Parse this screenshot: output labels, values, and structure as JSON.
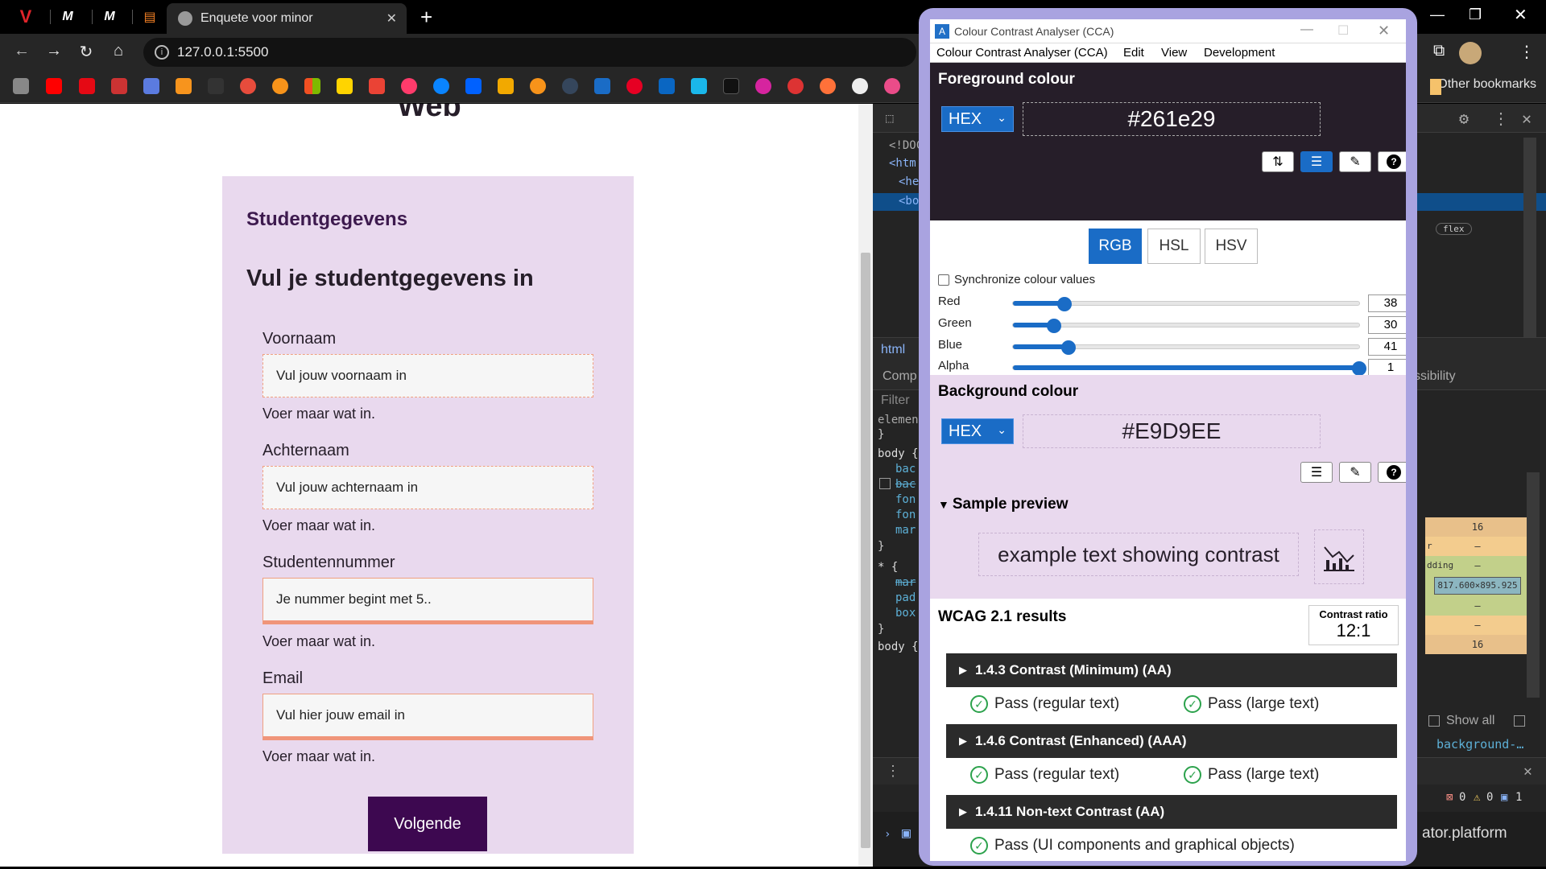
{
  "browser": {
    "tabs": [
      {
        "label": "V"
      },
      {
        "label": "M"
      },
      {
        "label": "M"
      }
    ],
    "active_tab_title": "Enquete voor minor",
    "url": "127.0.0.1:5500",
    "other_bookmarks": "Other bookmarks"
  },
  "page": {
    "heading": "Web",
    "section_label": "Studentgegevens",
    "form_title": "Vul je studentgegevens in",
    "fields": [
      {
        "label": "Voornaam",
        "placeholder": "Vul jouw voornaam in",
        "hint": "Voer maar wat in."
      },
      {
        "label": "Achternaam",
        "placeholder": "Vul jouw achternaam  in",
        "hint": "Voer maar wat in."
      },
      {
        "label": "Studentennummer",
        "placeholder": "Je nummer begint met 5..",
        "hint": "Voer maar wat in."
      },
      {
        "label": "Email",
        "placeholder": "Vul hier jouw email in",
        "hint": "Voer maar wat in."
      }
    ],
    "next_button": "Volgende"
  },
  "devtools": {
    "dom_lines": [
      "<!DOC",
      "<htm",
      "<he",
      "<bo"
    ],
    "flex_badge": "flex",
    "breadcrumb": "html",
    "tab_computed": "Comp",
    "tab_accessibility": "ssibility",
    "filter_placeholder": "Filter",
    "element_style": "elemen",
    "rules": [
      {
        "selector": "body {",
        "props": [
          "bac",
          "bac",
          "fon",
          "fon",
          "mar"
        ]
      },
      {
        "selector": "* {",
        "props": [
          "mar",
          "pad",
          "box"
        ]
      }
    ],
    "rule_body_next": "body {",
    "box_model": [
      "16",
      "–",
      "–",
      "817.600×895.925",
      "–",
      "–",
      "16"
    ],
    "box_labels": {
      "border": "r",
      "padding": "dding"
    },
    "show_all": "Show all",
    "computed_prop": "background-…",
    "errors": "0",
    "warnings": "0",
    "messages": "1",
    "console_tail": "ator.platform"
  },
  "cca": {
    "window_title": "Colour Contrast Analyser (CCA)",
    "menu": [
      "Colour Contrast Analyser (CCA)",
      "Edit",
      "View",
      "Development"
    ],
    "foreground": {
      "title": "Foreground colour",
      "format": "HEX",
      "value": "#261e29",
      "color": "#261e29"
    },
    "modes": [
      "RGB",
      "HSL",
      "HSV"
    ],
    "active_mode": "RGB",
    "sync_label": "Synchronize colour values",
    "sliders": [
      {
        "label": "Red",
        "value": 38,
        "fraction": 0.149
      },
      {
        "label": "Green",
        "value": 30,
        "fraction": 0.118
      },
      {
        "label": "Blue",
        "value": 41,
        "fraction": 0.161
      },
      {
        "label": "Alpha",
        "value": 1,
        "fraction": 1.0
      }
    ],
    "background": {
      "title": "Background colour",
      "format": "HEX",
      "value": "#E9D9EE",
      "color": "#e9d9ee"
    },
    "preview": {
      "title": "Sample preview",
      "text": "example text showing contrast"
    },
    "wcag": {
      "title": "WCAG 2.1 results",
      "ratio_label": "Contrast ratio",
      "ratio": "12:1",
      "criteria": [
        {
          "name": "1.4.3 Contrast (Minimum) (AA)",
          "results": [
            "Pass (regular text)",
            "Pass (large text)"
          ]
        },
        {
          "name": "1.4.6 Contrast (Enhanced) (AAA)",
          "results": [
            "Pass (regular text)",
            "Pass (large text)"
          ]
        },
        {
          "name": "1.4.11 Non-text Contrast (AA)",
          "results": [
            "Pass (UI components and graphical objects)"
          ]
        }
      ]
    }
  }
}
